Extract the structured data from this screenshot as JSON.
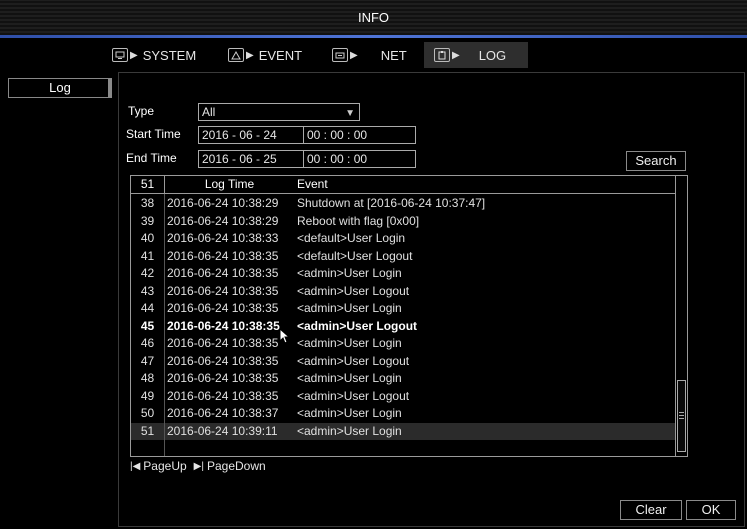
{
  "title": "INFO",
  "tabs": [
    {
      "label": "SYSTEM"
    },
    {
      "label": "EVENT"
    },
    {
      "label": "NET"
    },
    {
      "label": "LOG"
    }
  ],
  "sidebar": {
    "item": "Log"
  },
  "filters": {
    "type_label": "Type",
    "type_value": "All",
    "start_label": "Start Time",
    "start_date": "2016 - 06 - 24",
    "start_time": "00 : 00 : 00",
    "end_label": "End Time",
    "end_date": "2016 - 06 - 25",
    "end_time": "00 : 00 : 00",
    "search_label": "Search"
  },
  "log": {
    "count": "51",
    "col_time": "Log Time",
    "col_event": "Event",
    "rows": [
      {
        "idx": "38",
        "time": "2016-06-24 10:38:29",
        "event": "Shutdown at [2016-06-24 10:37:47]"
      },
      {
        "idx": "39",
        "time": "2016-06-24 10:38:29",
        "event": "Reboot with flag [0x00]"
      },
      {
        "idx": "40",
        "time": "2016-06-24 10:38:33",
        "event": "<default>User Login"
      },
      {
        "idx": "41",
        "time": "2016-06-24 10:38:35",
        "event": "<default>User Logout"
      },
      {
        "idx": "42",
        "time": "2016-06-24 10:38:35",
        "event": "<admin>User Login"
      },
      {
        "idx": "43",
        "time": "2016-06-24 10:38:35",
        "event": "<admin>User Logout"
      },
      {
        "idx": "44",
        "time": "2016-06-24 10:38:35",
        "event": "<admin>User Login"
      },
      {
        "idx": "45",
        "time": "2016-06-24 10:38:35",
        "event": "<admin>User Logout"
      },
      {
        "idx": "46",
        "time": "2016-06-24 10:38:35",
        "event": "<admin>User Login"
      },
      {
        "idx": "47",
        "time": "2016-06-24 10:38:35",
        "event": "<admin>User Logout"
      },
      {
        "idx": "48",
        "time": "2016-06-24 10:38:35",
        "event": "<admin>User Login"
      },
      {
        "idx": "49",
        "time": "2016-06-24 10:38:35",
        "event": "<admin>User Logout"
      },
      {
        "idx": "50",
        "time": "2016-06-24 10:38:37",
        "event": "<admin>User Login"
      },
      {
        "idx": "51",
        "time": "2016-06-24 10:39:11",
        "event": "<admin>User Login"
      }
    ]
  },
  "pager": {
    "prev": "PageUp",
    "next": "PageDown"
  },
  "actions": {
    "clear": "Clear",
    "ok": "OK"
  },
  "colors": {
    "accent": "#4f74d6",
    "selected_row": "#2b2b2b"
  }
}
